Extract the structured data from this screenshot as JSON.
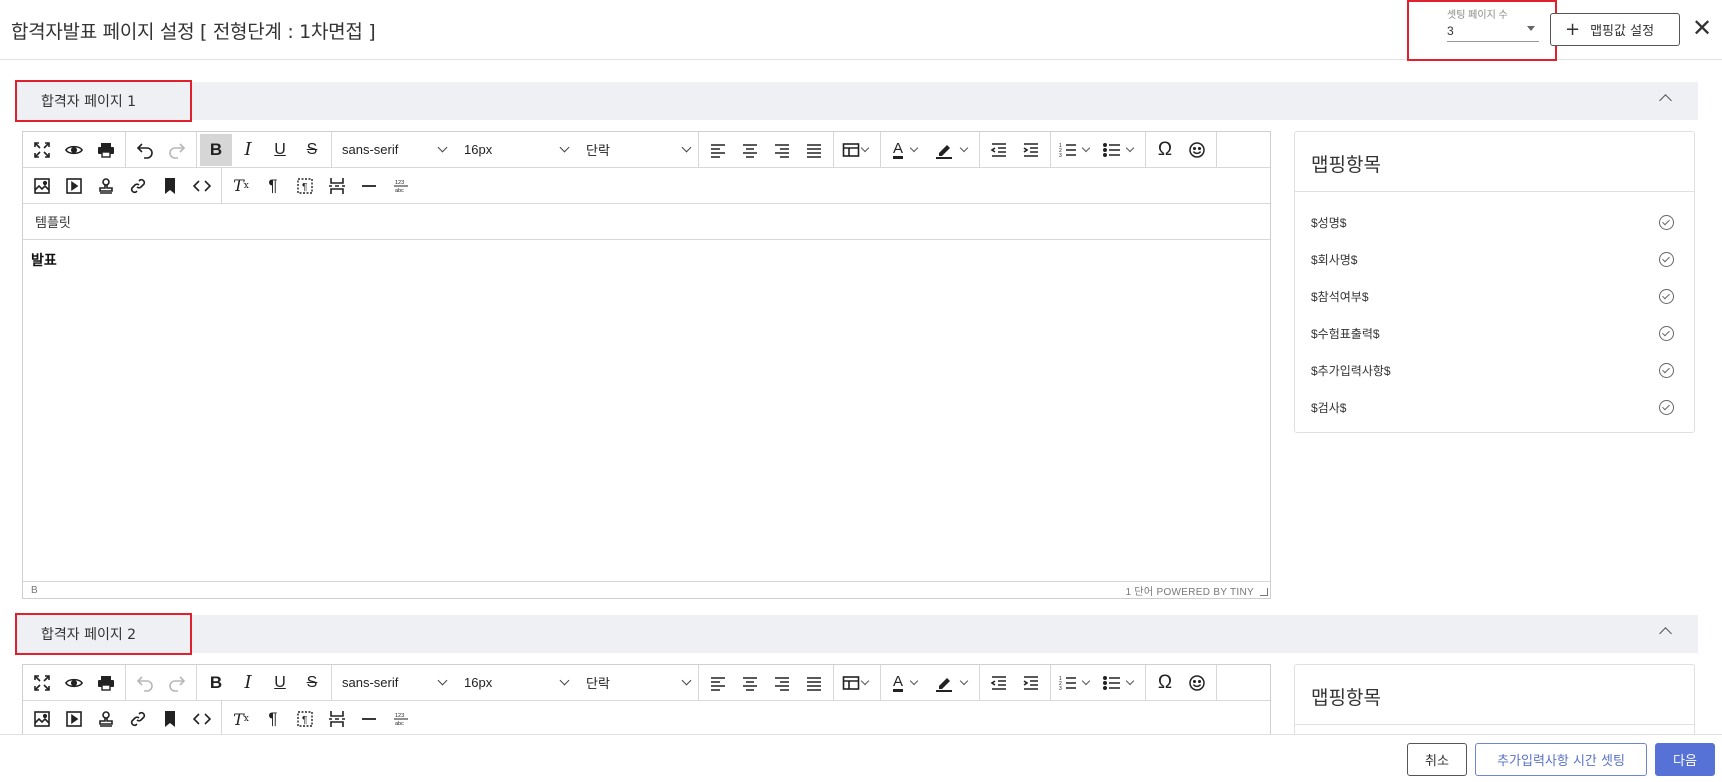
{
  "header": {
    "title": "합격자발표 페이지 설정 [ 전형단계 : 1차면접 ]",
    "page_count_label": "셋팅 페이지 수",
    "page_count_value": "3",
    "mapping_button_label": "맵핑값 설정",
    "close_symbol": "✕"
  },
  "sections": [
    {
      "label": "합격자 페이지 1"
    },
    {
      "label": "합격자 페이지 2"
    }
  ],
  "editor": {
    "font_family": "sans-serif",
    "font_size": "16px",
    "block_format": "단락",
    "menu_template": "템플릿",
    "content_text": "발표",
    "status_path": "B",
    "status_right": "1 단어  POWERED BY TINY"
  },
  "mapping_panel": {
    "title": "맵핑항목",
    "items": [
      "$성명$",
      "$회사명$",
      "$참석여부$",
      "$수험표출력$",
      "$추가입력사항$",
      "$검사$"
    ]
  },
  "footer": {
    "cancel_label": "취소",
    "time_setting_label": "추가입력사항 시간 셋팅",
    "next_label": "다음"
  },
  "colors": {
    "highlight_border": "#e0202c",
    "primary": "#5672d6",
    "section_bg": "#eef0f4"
  }
}
